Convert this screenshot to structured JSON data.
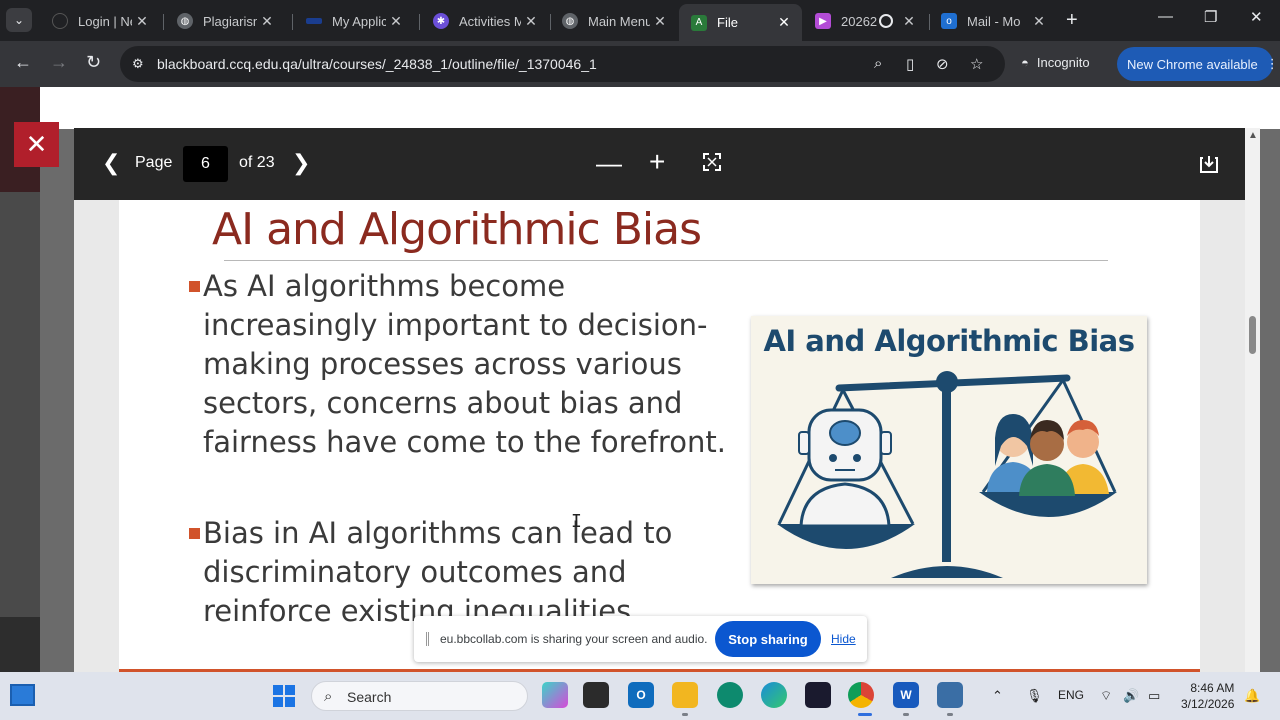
{
  "browser": {
    "tabs": [
      {
        "title": "Login | Ne",
        "icon": "page-icon",
        "active": false
      },
      {
        "title": "Plagiarism",
        "icon": "globe-icon",
        "active": false
      },
      {
        "title": "My Applic",
        "icon": "page-icon",
        "active": false
      },
      {
        "title": "Activities M",
        "icon": "app-icon",
        "active": false
      },
      {
        "title": "Main Menu",
        "icon": "globe-icon",
        "active": false
      },
      {
        "title": "File",
        "icon": "blackboard-icon",
        "active": true
      },
      {
        "title": "20262",
        "icon": "video-icon",
        "active": false
      },
      {
        "title": "Mail - Mo",
        "icon": "outlook-icon",
        "active": false
      }
    ],
    "url": "blackboard.ccq.edu.qa/ultra/courses/_24838_1/outline/file/_1370046_1",
    "incognito_label": "Incognito",
    "update_label": "New Chrome available"
  },
  "viewer": {
    "page_label": "Page",
    "current_page": "6",
    "total_label": "of 23"
  },
  "slide": {
    "title": "AI and Algorithmic Bias",
    "bullets": [
      "As AI algorithms become increasingly important to decision-making processes across various sectors, concerns about bias and fairness have come to the forefront.",
      "Bias in AI algorithms can lead to discriminatory outcomes and reinforce existing inequalities."
    ],
    "image_title": "AI and Algorithmic Bias",
    "accent_color": "#d1532b",
    "title_color": "#8b2a1f"
  },
  "share_bar": {
    "message": "eu.bbcollab.com is sharing your screen and audio.",
    "stop_label": "Stop sharing",
    "hide_label": "Hide"
  },
  "taskbar": {
    "search_label": "Search",
    "language": "ENG",
    "time": "8:46 AM",
    "date": "3/12/2026"
  }
}
